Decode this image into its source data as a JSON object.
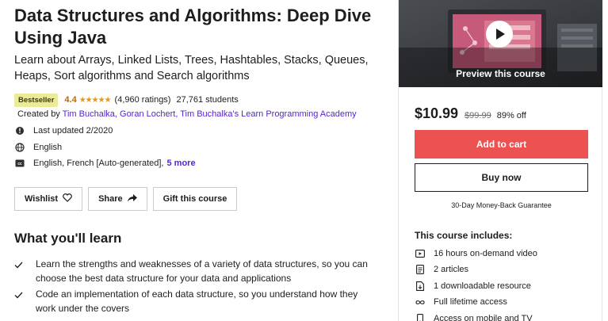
{
  "course": {
    "title": "Data Structures and Algorithms: Deep Dive Using Java",
    "subtitle": "Learn about Arrays, Linked Lists, Trees, Hashtables, Stacks, Queues, Heaps, Sort algorithms and Search algorithms",
    "badge": "Bestseller",
    "rating": "4.4",
    "stars": "★★★★★",
    "ratings_count": "(4,960 ratings)",
    "students": "27,761 students",
    "created_by_label": "Created by",
    "authors": "Tim Buchalka, Goran Lochert, Tim Buchalka's Learn Programming Academy",
    "last_updated": "Last updated 2/2020",
    "language": "English",
    "captions": "English, French [Auto-generated],",
    "captions_more": "5 more"
  },
  "actions": {
    "wishlist": "Wishlist",
    "share": "Share",
    "gift": "Gift this course"
  },
  "learn": {
    "title": "What you'll learn",
    "items": [
      "Learn the strengths and weaknesses of a variety of data structures, so you can choose the best data structure for your data and applications",
      "Code an implementation of each data structure, so you understand how they work under the covers"
    ]
  },
  "sidebar": {
    "preview_label": "Preview this course",
    "price": "$10.99",
    "original_price": "$99.99",
    "discount": "89% off",
    "add_to_cart": "Add to cart",
    "buy_now": "Buy now",
    "guarantee": "30-Day Money-Back Guarantee",
    "includes_title": "This course includes:",
    "includes": [
      {
        "icon": "video-icon",
        "text": "16 hours on-demand video"
      },
      {
        "icon": "article-icon",
        "text": "2 articles"
      },
      {
        "icon": "file-download-icon",
        "text": "1 downloadable resource"
      },
      {
        "icon": "infinity-icon",
        "text": "Full lifetime access"
      },
      {
        "icon": "mobile-tv-icon",
        "text": "Access on mobile and TV"
      }
    ]
  },
  "colors": {
    "accent_purple": "#5624d0",
    "cart_red": "#ec5252",
    "rating_orange": "#b4690e",
    "badge_yellow": "#eceb98"
  }
}
